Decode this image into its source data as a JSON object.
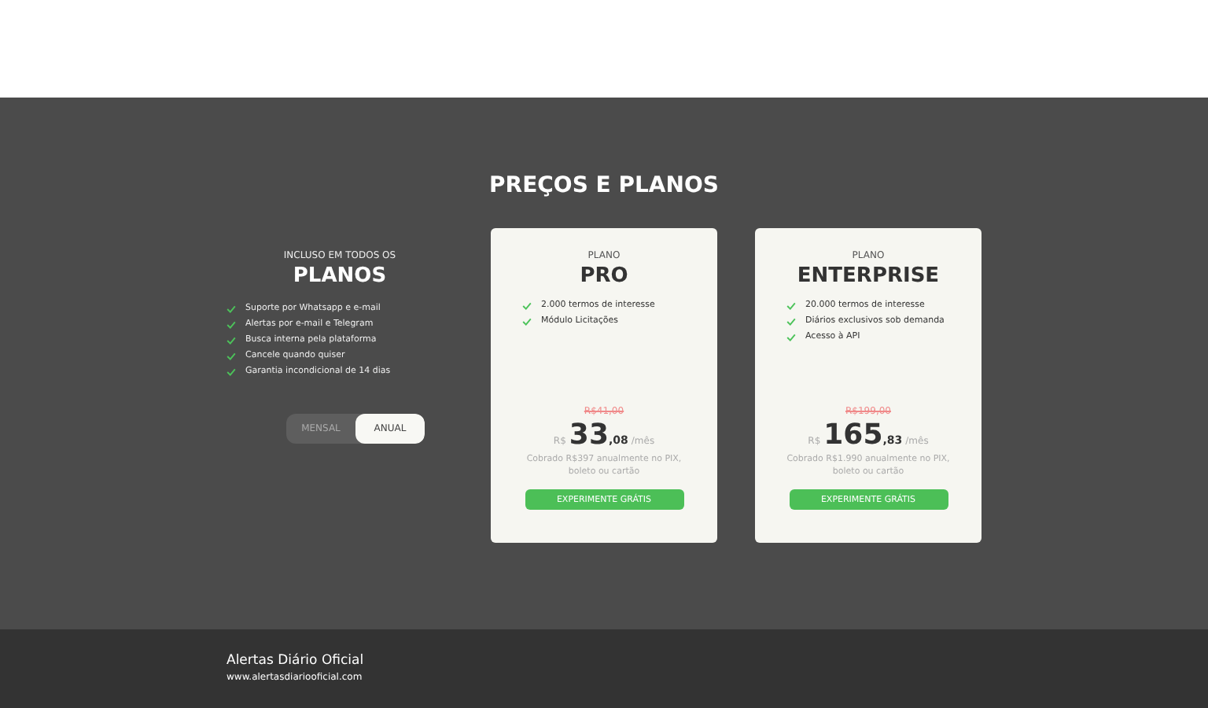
{
  "title": "PREÇOS E PLANOS",
  "included": {
    "eyebrow": "INCLUSO EM TODOS OS",
    "heading": "PLANOS",
    "features": [
      "Suporte por Whatsapp e e-mail",
      "Alertas por e-mail e Telegram",
      "Busca interna pela plataforma",
      "Cancele quando quiser",
      "Garantia incondicional de 14 dias"
    ]
  },
  "billing": [
    {
      "label": "MENSAL",
      "selected": false
    },
    {
      "label": "ANUAL",
      "selected": true
    }
  ],
  "plans": [
    {
      "eyebrow": "PLANO",
      "name": "PRO",
      "features": [
        "2.000 termos de interesse",
        "Módulo Licitações"
      ],
      "old_price": "R$41,00",
      "currency": "R$",
      "price": "33",
      "cents": ",08",
      "period": "/mês",
      "note": "Cobrado R$397 anualmente no PIX, boleto ou cartão",
      "button": "EXPERIMENTE GRÁTIS"
    },
    {
      "eyebrow": "PLANO",
      "name": "ENTERPRISE",
      "features": [
        "20.000 termos de interesse",
        "Diários exclusivos sob demanda",
        "Acesso à API"
      ],
      "old_price": "R$199,00",
      "currency": "R$",
      "price": "165",
      "cents": ",83",
      "period": "/mês",
      "note": "Cobrado R$1.990 anualmente no PIX, boleto ou cartão",
      "button": "EXPERIMENTE GRÁTIS"
    }
  ],
  "footer": {
    "name": "Alertas Diário Oficial",
    "url": "www.alertasdiariooficial.com"
  }
}
